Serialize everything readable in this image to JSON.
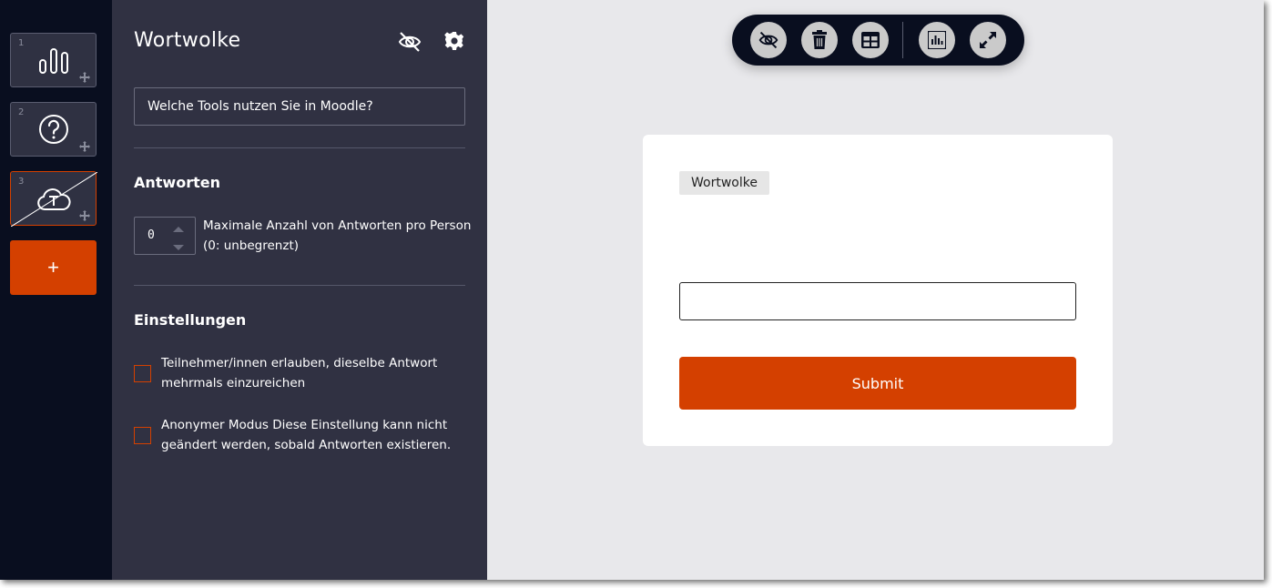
{
  "slides": [
    {
      "number": "1",
      "icon": "bar-chart-icon"
    },
    {
      "number": "2",
      "icon": "question-circle-icon"
    },
    {
      "number": "3",
      "icon": "word-cloud-icon",
      "active": true
    }
  ],
  "add_slide_label": "+",
  "editor": {
    "title": "Wortwolke",
    "question_value": "Welche Tools nutzen Sie in Moodle?",
    "answers_heading": "Antworten",
    "max_answers_value": "0",
    "max_answers_label": "Maximale Anzahl von Antworten pro Person (0: unbegrenzt)",
    "settings_heading": "Einstellungen",
    "checkbox_same_answer": "Teilnehmer/innen erlauben, dieselbe Antwort mehrmals einzureichen",
    "checkbox_anonymous": "Anonymer Modus Diese Einstellung kann nicht geändert werden, sobald Antworten existieren."
  },
  "toolbar": {
    "buttons": [
      "eye-slash-icon",
      "trash-icon",
      "table-icon",
      "chart-icon",
      "expand-icon"
    ]
  },
  "preview": {
    "tag": "Wortwolke",
    "answer_value": "",
    "submit_label": "Submit"
  },
  "colors": {
    "accent": "#d44000",
    "panel": "#303142",
    "strip": "#090e1f",
    "preview_bg": "#e8e8eb"
  }
}
